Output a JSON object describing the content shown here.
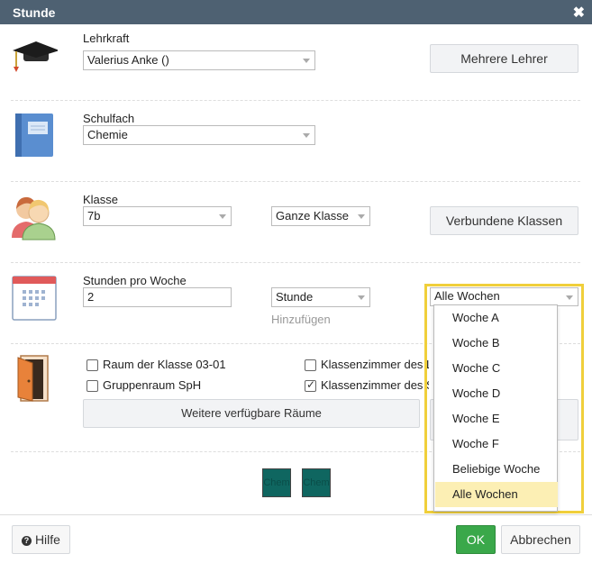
{
  "dialog": {
    "title": "Stunde",
    "close_glyph": "✖"
  },
  "teacher": {
    "label": "Lehrkraft",
    "value": "Valerius Anke ()",
    "button": "Mehrere Lehrer",
    "icon": "graduation-cap-icon"
  },
  "subject": {
    "label": "Schulfach",
    "value": "Chemie",
    "icon": "book-icon"
  },
  "class": {
    "label": "Klasse",
    "value": "7b",
    "group_value": "Ganze Klasse",
    "button": "Verbundene Klassen",
    "icon": "people-icon"
  },
  "hours": {
    "label": "Stunden pro Woche",
    "value": "2",
    "unit_value": "Stunde",
    "add_hint": "Hinzufügen",
    "week_value": "Alle Wochen",
    "icon": "calendar-icon"
  },
  "rooms": {
    "icon": "door-icon",
    "options": [
      {
        "label": "Raum der Klasse 03-01",
        "checked": false
      },
      {
        "label": "Klassenzimmer des L",
        "checked": false
      },
      {
        "label": "Gruppenraum SpH",
        "checked": false
      },
      {
        "label": "Klassenzimmer des S",
        "checked": true
      }
    ],
    "more_button": "Weitere verfügbare Räume"
  },
  "chips": [
    "Chem",
    "Chem"
  ],
  "week_dropdown": {
    "options": [
      "Woche A",
      "Woche B",
      "Woche C",
      "Woche D",
      "Woche E",
      "Woche F",
      "Beliebige Woche",
      "Alle Wochen"
    ],
    "selected": "Alle Wochen"
  },
  "footer": {
    "help": "Hilfe",
    "ok": "OK",
    "cancel": "Abbrechen"
  },
  "colors": {
    "titlebar": "#4e6172",
    "ok": "#3aa84a",
    "highlight_frame": "#f0cf3b",
    "selected_option": "#fcefb4",
    "chip": "#0f6660"
  }
}
